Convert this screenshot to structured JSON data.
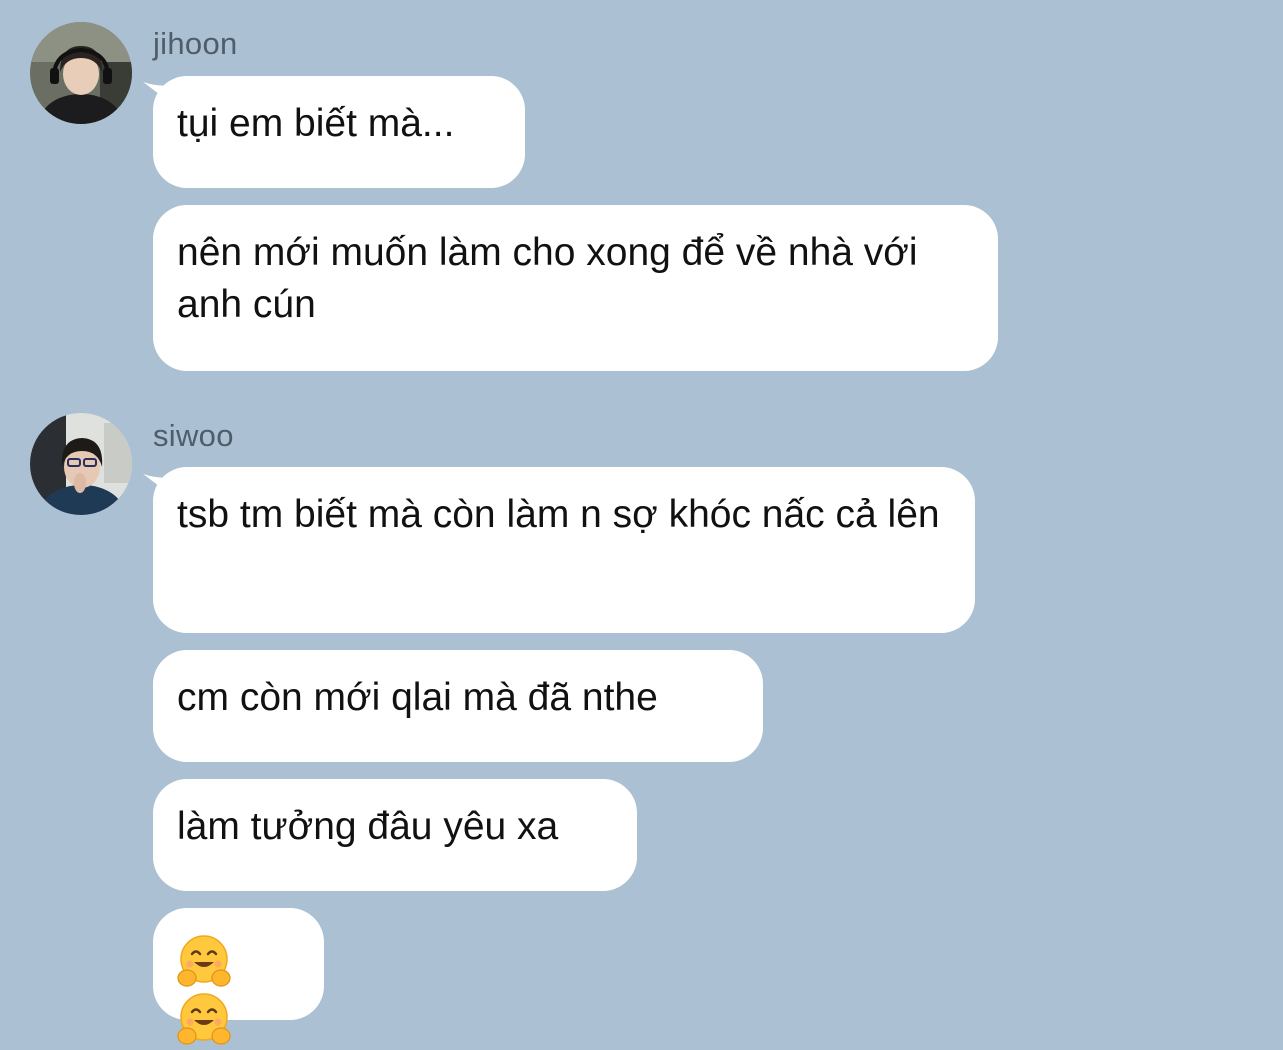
{
  "conversation": [
    {
      "sender": "jihoon",
      "messages": [
        "tụi em biết mà...",
        "nên mới muốn làm cho xong để về nhà với anh cún"
      ]
    },
    {
      "sender": "siwoo",
      "messages": [
        "tsb tm biết mà còn làm n sợ khóc nấc cả lên",
        "cm còn mới qlai mà đã nthe",
        "làm tưởng đâu yêu xa"
      ],
      "emoji_message": [
        "hugging-face-emoji",
        "hugging-face-emoji"
      ]
    }
  ],
  "colors": {
    "background": "#abc1d3",
    "bubble": "#ffffff",
    "sender_name": "#4f5d6a",
    "text": "#111111"
  }
}
